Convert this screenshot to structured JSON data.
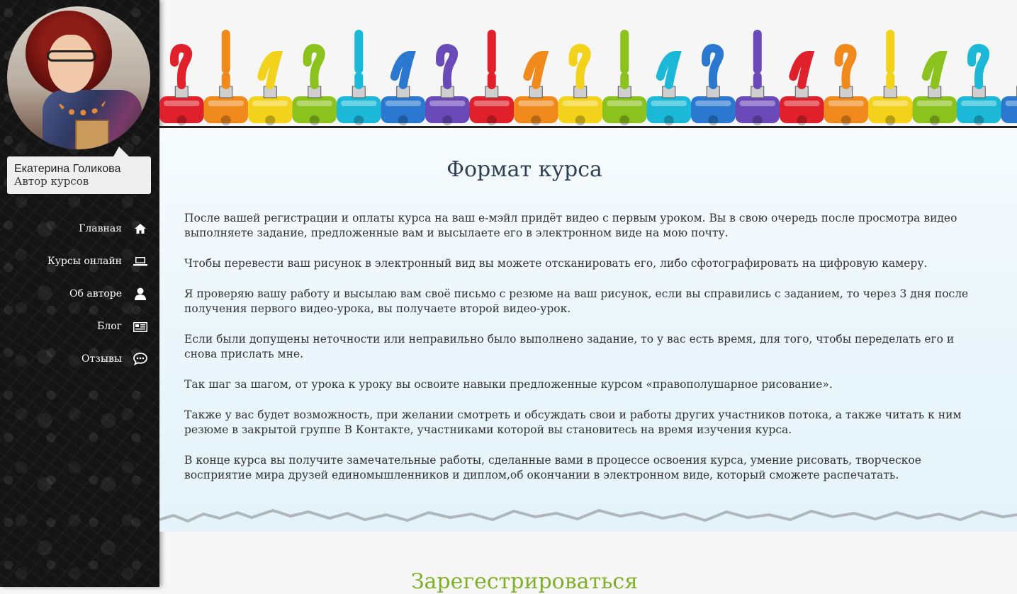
{
  "sidebar": {
    "author_name": "Екатерина Голикова",
    "author_role": "Автор курсов",
    "nav": [
      {
        "label": "Главная",
        "icon": "home-icon"
      },
      {
        "label": "Курсы онлайн",
        "icon": "laptop-icon"
      },
      {
        "label": "Об авторе",
        "icon": "user-icon"
      },
      {
        "label": "Блог",
        "icon": "newspaper-icon"
      },
      {
        "label": "Отзывы",
        "icon": "comment-icon"
      }
    ]
  },
  "main": {
    "title": "Формат курса",
    "paragraphs": [
      "После вашей регистрации и оплаты курса на ваш е-мэйл придёт видео с первым уроком. Вы в свою очередь после просмотра видео выполняете задание, предложенные вам и высылаете его в электронном виде на мою почту.",
      "Чтобы перевести ваш рисунок в электронный вид вы можете отсканировать его, либо сфотографировать на цифровую камеру.",
      "Я проверяю вашу работу и высылаю вам своё письмо с резюме на ваш рисунок, если вы справились с заданием, то через 3 дня после получения первого видео-урока, вы получаете второй видео-урок.",
      "Если были допущены неточности или неправильно было выполнено задание, то у вас есть время, для того, чтобы переделать его и снова прислать мне.",
      "Так шаг за шагом, от урока к уроку вы освоите навыки предложенные курсом «правополушарное рисование».",
      "Также у вас будет возможность, при желании смотреть и обсуждать свои и работы других участников потока, а также читать к ним резюме в закрытой группе В Контакте, участниками которой вы становитесь на время изучения курса.",
      "В конце курса вы получите замечательные работы, сделанные вами в процессе освоения курса, умение рисовать, творческое восприятие мира друзей единомышленников и диплом,об окончании в электронном виде, который сможете распечатать."
    ],
    "register_heading": "Зарегестрироваться"
  },
  "colors": {
    "sidebar_bg": "#141414",
    "title": "#2f3f55",
    "register": "#7fb02a",
    "paint_tubes": [
      "#e0202a",
      "#f08a1c",
      "#f2d21a",
      "#8cc21e",
      "#1cb8d8",
      "#2a78d0",
      "#6a4ab8"
    ]
  }
}
